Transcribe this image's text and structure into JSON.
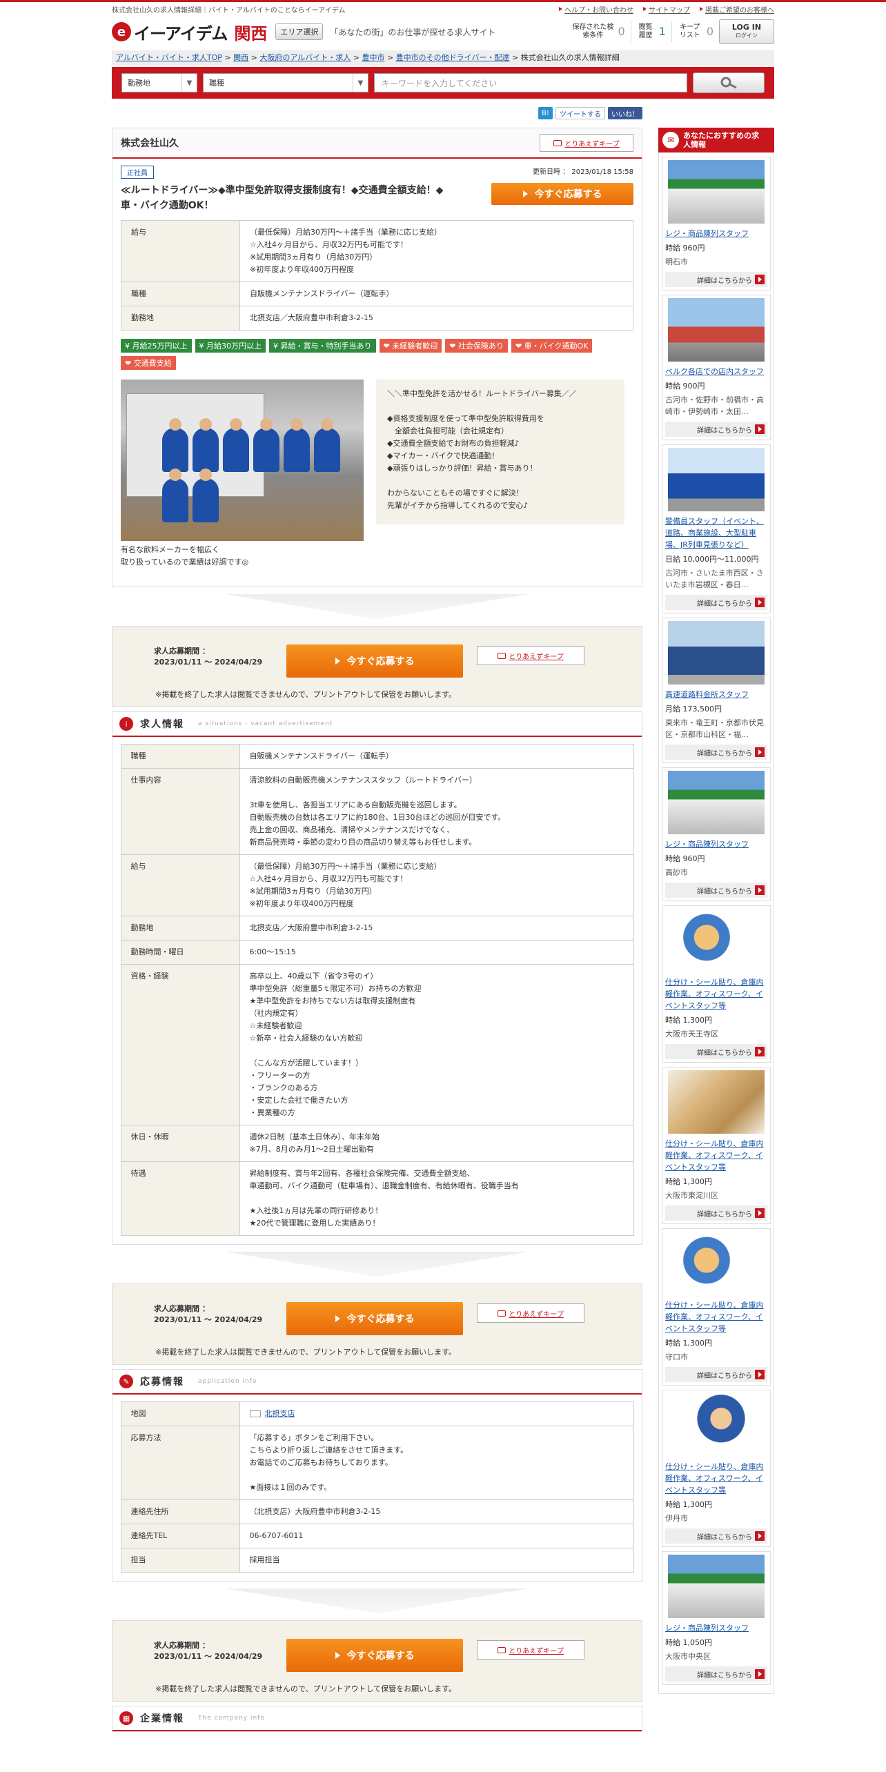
{
  "topbar": {
    "description": "株式会社山久の求人情報詳細｜バイト・アルバイトのことならイーアイデム",
    "links": [
      "ヘルプ・お問い合わせ",
      "サイトマップ",
      "掲載ご希望のお客様へ"
    ]
  },
  "header": {
    "logo_text": "イーアイデム",
    "region": "関西",
    "area_select": "エリア選択",
    "catchphrase": "「あなたの街」のお仕事が探せる求人サイト",
    "saved_search_label": "保存された検索条件",
    "saved_search_count": "0",
    "history_label": "閲覧履歴",
    "history_count": "1",
    "keep_label": "キープリスト",
    "keep_count": "0",
    "login_label": "LOG IN",
    "login_sub": "ログイン"
  },
  "breadcrumb": [
    "アルバイト・バイト・求人TOP",
    "関西",
    "大阪府のアルバイト・求人",
    "豊中市",
    "豊中市のその他ドライバー・配達",
    "株式会社山久の求人情報詳細"
  ],
  "search": {
    "location_placeholder": "勤務地",
    "job_placeholder": "職種",
    "keyword_placeholder": "キーワードを入力してください"
  },
  "social": {
    "hatena": "B!",
    "tweet": "ツイートする",
    "like": "いいね！"
  },
  "company": {
    "name": "株式会社山久",
    "keep_button": "とりあえずキープ",
    "employment_type": "正社員",
    "updated": "更新日時 ： 2023/01/18 15:58",
    "job_title": "≪ルートドライバー≫◆準中型免許取得支援制度有！◆交通費全額支給！◆車・バイク通勤OK！",
    "apply_button": "今すぐ応募する",
    "summary": [
      {
        "label": "給与",
        "value": "（最低保障）月給30万円〜＋諸手当（業務に応じ支給）\n☆入社4ヶ月目から、月収32万円も可能です！\n※試用期間3ヵ月有り（月給30万円）\n※初年度より年収400万円程度"
      },
      {
        "label": "職種",
        "value": "自販機メンテナンスドライバー（運転手）"
      },
      {
        "label": "勤務地",
        "value": "北摂支店／大阪府豊中市利倉3-2-15"
      }
    ],
    "tags": [
      {
        "text": "月給25万円以上",
        "color": "green"
      },
      {
        "text": "月給30万円以上",
        "color": "green"
      },
      {
        "text": "昇給・賞与・特別手当あり",
        "color": "green"
      },
      {
        "text": "未経験者歓迎",
        "color": "red"
      },
      {
        "text": "社会保険あり",
        "color": "red"
      },
      {
        "text": "車・バイク通勤OK",
        "color": "red"
      },
      {
        "text": "交通費支給",
        "color": "red"
      }
    ],
    "photo_caption": "有名な飲料メーカーを幅広く\n取り扱っているので業績は好調です◎",
    "pr_text": "＼＼準中型免許を活かせる！ルートドライバー募集／／\n\n◆資格支援制度を使って準中型免許取得費用を\n　全額会社負担可能（会社規定有）\n◆交通費全額支給でお財布の負担軽減♪\n◆マイカー・バイクで快適通勤！\n◆頑張りはしっかり評価！昇給・賞与あり！\n\nわからないこともその場ですぐに解決！\n先輩がイチから指導してくれるので安心♪"
  },
  "apply_box": {
    "period_label": "求人応募期間 ：",
    "period": "2023/01/11 ～ 2024/04/29",
    "button": "今すぐ応募する",
    "keep": "とりあえずキープ",
    "note": "※掲載を終了した求人は閲覧できませんので、プリントアウトして保管をお願いします。"
  },
  "job_info": {
    "title": "求人情報",
    "subtitle": "a situations - vacant advertisement",
    "rows": [
      {
        "label": "職種",
        "value": "自販機メンテナンスドライバー（運転手）"
      },
      {
        "label": "仕事内容",
        "value": "清涼飲料の自動販売機メンテナンススタッフ（ルートドライバー）\n\n3t車を使用し、各担当エリアにある自動販売機を巡回します。\n自動販売機の台数は各エリアに約180台、1日30台ほどの巡回が目安です。\n売上金の回収、商品補充、清掃やメンテナンスだけでなく、\n新商品発売時・季節の変わり目の商品切り替え等もお任せします。"
      },
      {
        "label": "給与",
        "value": "（最低保障）月給30万円〜＋諸手当（業務に応じ支給）\n☆入社4ヶ月目から、月収32万円も可能です！\n※試用期間3ヵ月有り（月給30万円）\n※初年度より年収400万円程度"
      },
      {
        "label": "勤務地",
        "value": "北摂支店／大阪府豊中市利倉3-2-15"
      },
      {
        "label": "勤務時間・曜日",
        "value": "6:00〜15:15"
      },
      {
        "label": "資格・経験",
        "value": "高卒以上、40歳以下（省令3号のイ）\n準中型免許（総重量5ｔ限定不可）お持ちの方歓迎\n★準中型免許をお持ちでない方は取得支援制度有\n（社内規定有）\n☆未経験者歓迎\n☆新卒・社会人経験のない方歓迎\n\n（こんな方が活躍しています！）\n・フリーターの方\n・ブランクのある方\n・安定した会社で働きたい方\n・異業種の方"
      },
      {
        "label": "休日・休暇",
        "value": "週休2日制（基本土日休み）、年末年始\n※7月、8月のみ月1〜2日土曜出勤有"
      },
      {
        "label": "待遇",
        "value": "昇給制度有、賞与年2回有、各種社会保険完備、交通費全額支給、\n車通勤可、バイク通勤可（駐車場有）、退職金制度有、有給休暇有、役職手当有\n\n★入社後1ヵ月は先輩の同行研修あり！\n★20代で管理職に登用した実績あり！"
      }
    ]
  },
  "application": {
    "title": "応募情報",
    "subtitle": "application info",
    "map_label": "地図",
    "map_link": "北摂支店",
    "rows": [
      {
        "label": "応募方法",
        "value": "「応募する」ボタンをご利用下さい。\nこちらより折り返しご連絡をさせて頂きます。\nお電話でのご応募もお待ちしております。\n\n★面接は１回のみです。"
      },
      {
        "label": "連絡先住所",
        "value": "（北摂支店）大阪府豊中市利倉3-2-15"
      },
      {
        "label": "連絡先TEL",
        "value": "06-6707-6011"
      },
      {
        "label": "担当",
        "value": "採用担当"
      }
    ]
  },
  "company_section": {
    "title": "企業情報",
    "subtitle": "The company info"
  },
  "sidebar": {
    "heading": "あなたにおすすめの求人情報",
    "more_label": "詳細はこちらから",
    "items": [
      {
        "title": "レジ・商品陳列スタッフ",
        "wage": "時給 960円",
        "location": "明石市",
        "thumb": "store"
      },
      {
        "title": "ベルク各店での店内スタッフ",
        "wage": "時給 900円",
        "location": "古河市・佐野市・前橋市・高崎市・伊勢崎市・太田…",
        "thumb": "shop"
      },
      {
        "title": "警備員スタッフ（イベント、道路、商業施設、大型駐車場、JR列車見張りなど）",
        "wage": "日給 10,000円〜11,000円",
        "location": "古河市・さいたま市西区・さいたま市岩槻区・春日…",
        "thumb": "guard"
      },
      {
        "title": "高速道路料金所スタッフ",
        "wage": "月給 173,500円",
        "location": "東来市・竜王町・京都市伏見区・京都市山科区・福…",
        "thumb": "group"
      },
      {
        "title": "レジ・商品陳列スタッフ",
        "wage": "時給 960円",
        "location": "高砂市",
        "thumb": "store"
      },
      {
        "title": "仕分け・シール貼り、倉庫内軽作業、オフィスワーク、イベントスタッフ等",
        "wage": "時給 1,300円",
        "location": "大阪市天王寺区",
        "thumb": "illust"
      },
      {
        "title": "仕分け・シール貼り、倉庫内軽作業、オフィスワーク、イベントスタッフ等",
        "wage": "時給 1,300円",
        "location": "大阪市東淀川区",
        "thumb": "boxes"
      },
      {
        "title": "仕分け・シール貼り、倉庫内軽作業、オフィスワーク、イベントスタッフ等",
        "wage": "時給 1,300円",
        "location": "守口市",
        "thumb": "illust"
      },
      {
        "title": "仕分け・シール貼り、倉庫内軽作業、オフィスワーク、イベントスタッフ等",
        "wage": "時給 1,300円",
        "location": "伊丹市",
        "thumb": "worker"
      },
      {
        "title": "レジ・商品陳列スタッフ",
        "wage": "時給 1,050円",
        "location": "大阪市中央区",
        "thumb": "store"
      }
    ]
  },
  "colors": {
    "brand_red": "#c8161d",
    "apply_orange": "#f7931e",
    "tag_green": "#2e8b3d",
    "tag_red": "#e85d4a",
    "table_header": "#f4f1e8"
  }
}
